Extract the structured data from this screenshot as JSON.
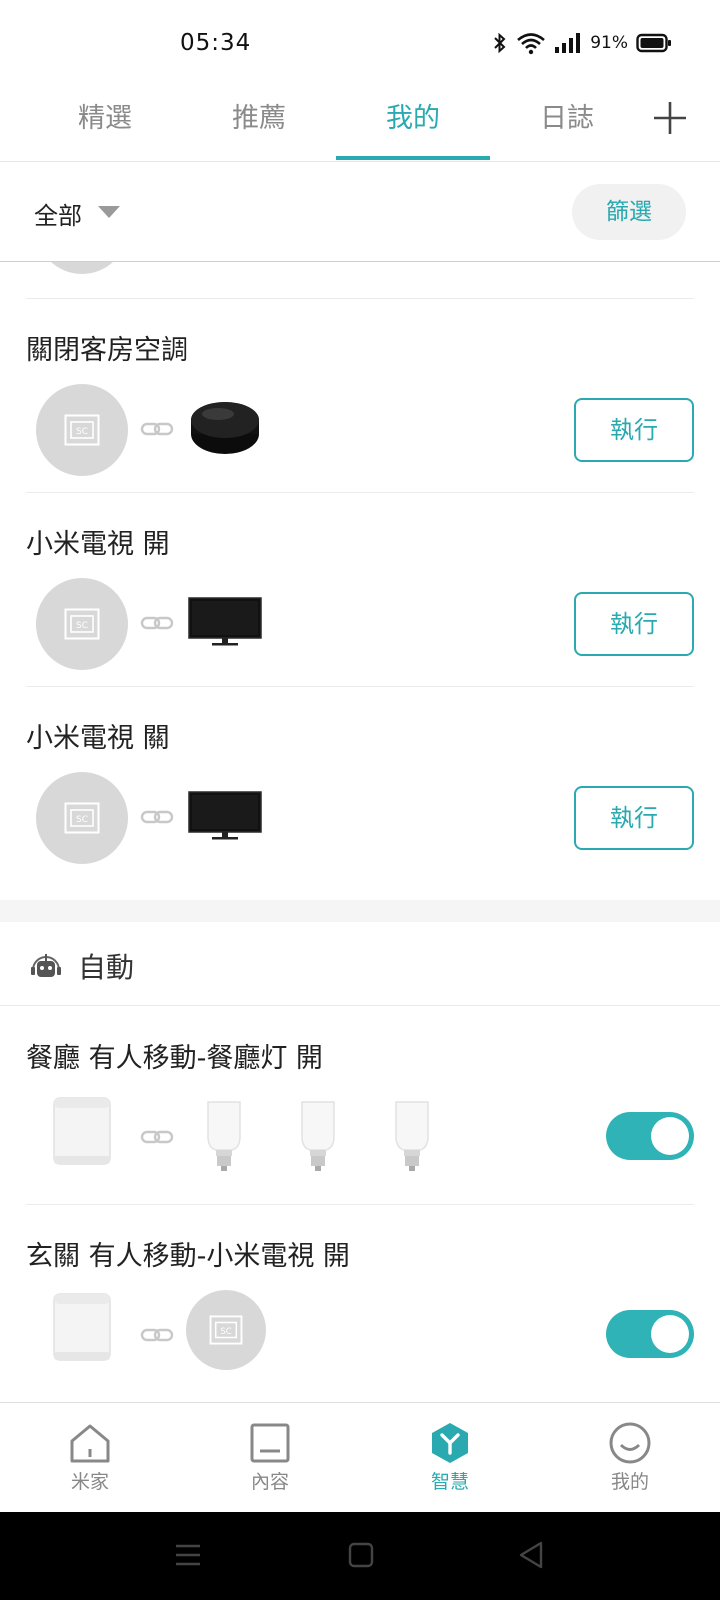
{
  "status_bar": {
    "time": "05:34",
    "battery": "91%"
  },
  "tabs": [
    {
      "label": "精選"
    },
    {
      "label": "推薦"
    },
    {
      "label": "我的"
    },
    {
      "label": "日誌"
    }
  ],
  "active_tab": "我的",
  "filter": {
    "all_label": "全部",
    "filter_button": "篩選"
  },
  "scenes": [
    {
      "title": "關閉客房空調",
      "device": "remote-hub",
      "action": "執行"
    },
    {
      "title": "小米電視 開",
      "device": "tv",
      "action": "執行"
    },
    {
      "title": "小米電視 關",
      "device": "tv",
      "action": "執行"
    }
  ],
  "auto_section": {
    "title": "自動"
  },
  "automations": [
    {
      "title": "餐廳 有人移動-餐廳灯 開",
      "trigger": "motion-sensor",
      "targets": [
        "bulb",
        "bulb",
        "bulb"
      ],
      "enabled": true
    },
    {
      "title": "玄關 有人移動-小米電視 開",
      "trigger": "motion-sensor",
      "targets": [
        "scene"
      ],
      "enabled": true
    }
  ],
  "bottom_nav": [
    {
      "label": "米家",
      "icon": "home-icon"
    },
    {
      "label": "內容",
      "icon": "content-icon"
    },
    {
      "label": "智慧",
      "icon": "smart-icon"
    },
    {
      "label": "我的",
      "icon": "profile-icon"
    }
  ],
  "active_nav": "智慧",
  "colors": {
    "accent": "#2aaab0",
    "toggle_on": "#2fb3b6",
    "scene_circle": "#d8d8d8"
  }
}
